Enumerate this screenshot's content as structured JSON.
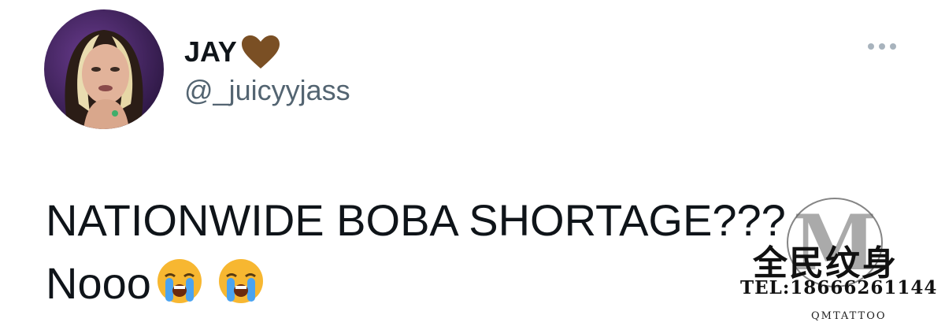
{
  "author": {
    "display_name": "JAY",
    "handle": "@_juicyyjass",
    "name_emoji": "brown-heart-icon",
    "avatar": "profile-photo"
  },
  "tweet": {
    "line1": "NATIONWIDE BOBA SHORTAGE???",
    "line2": "Nooo",
    "emojis": [
      "loudly-crying-face-icon",
      "loudly-crying-face-icon"
    ]
  },
  "more_menu": {
    "icon": "more-horizontal-icon"
  },
  "watermark": {
    "brand": "全民纹身",
    "tel": "TEL:18666261144",
    "sub": "QMTATTOO",
    "seal_letter": "M"
  },
  "colors": {
    "text": "#0f1419",
    "secondary": "#536471",
    "heart": "#7a4f24"
  }
}
